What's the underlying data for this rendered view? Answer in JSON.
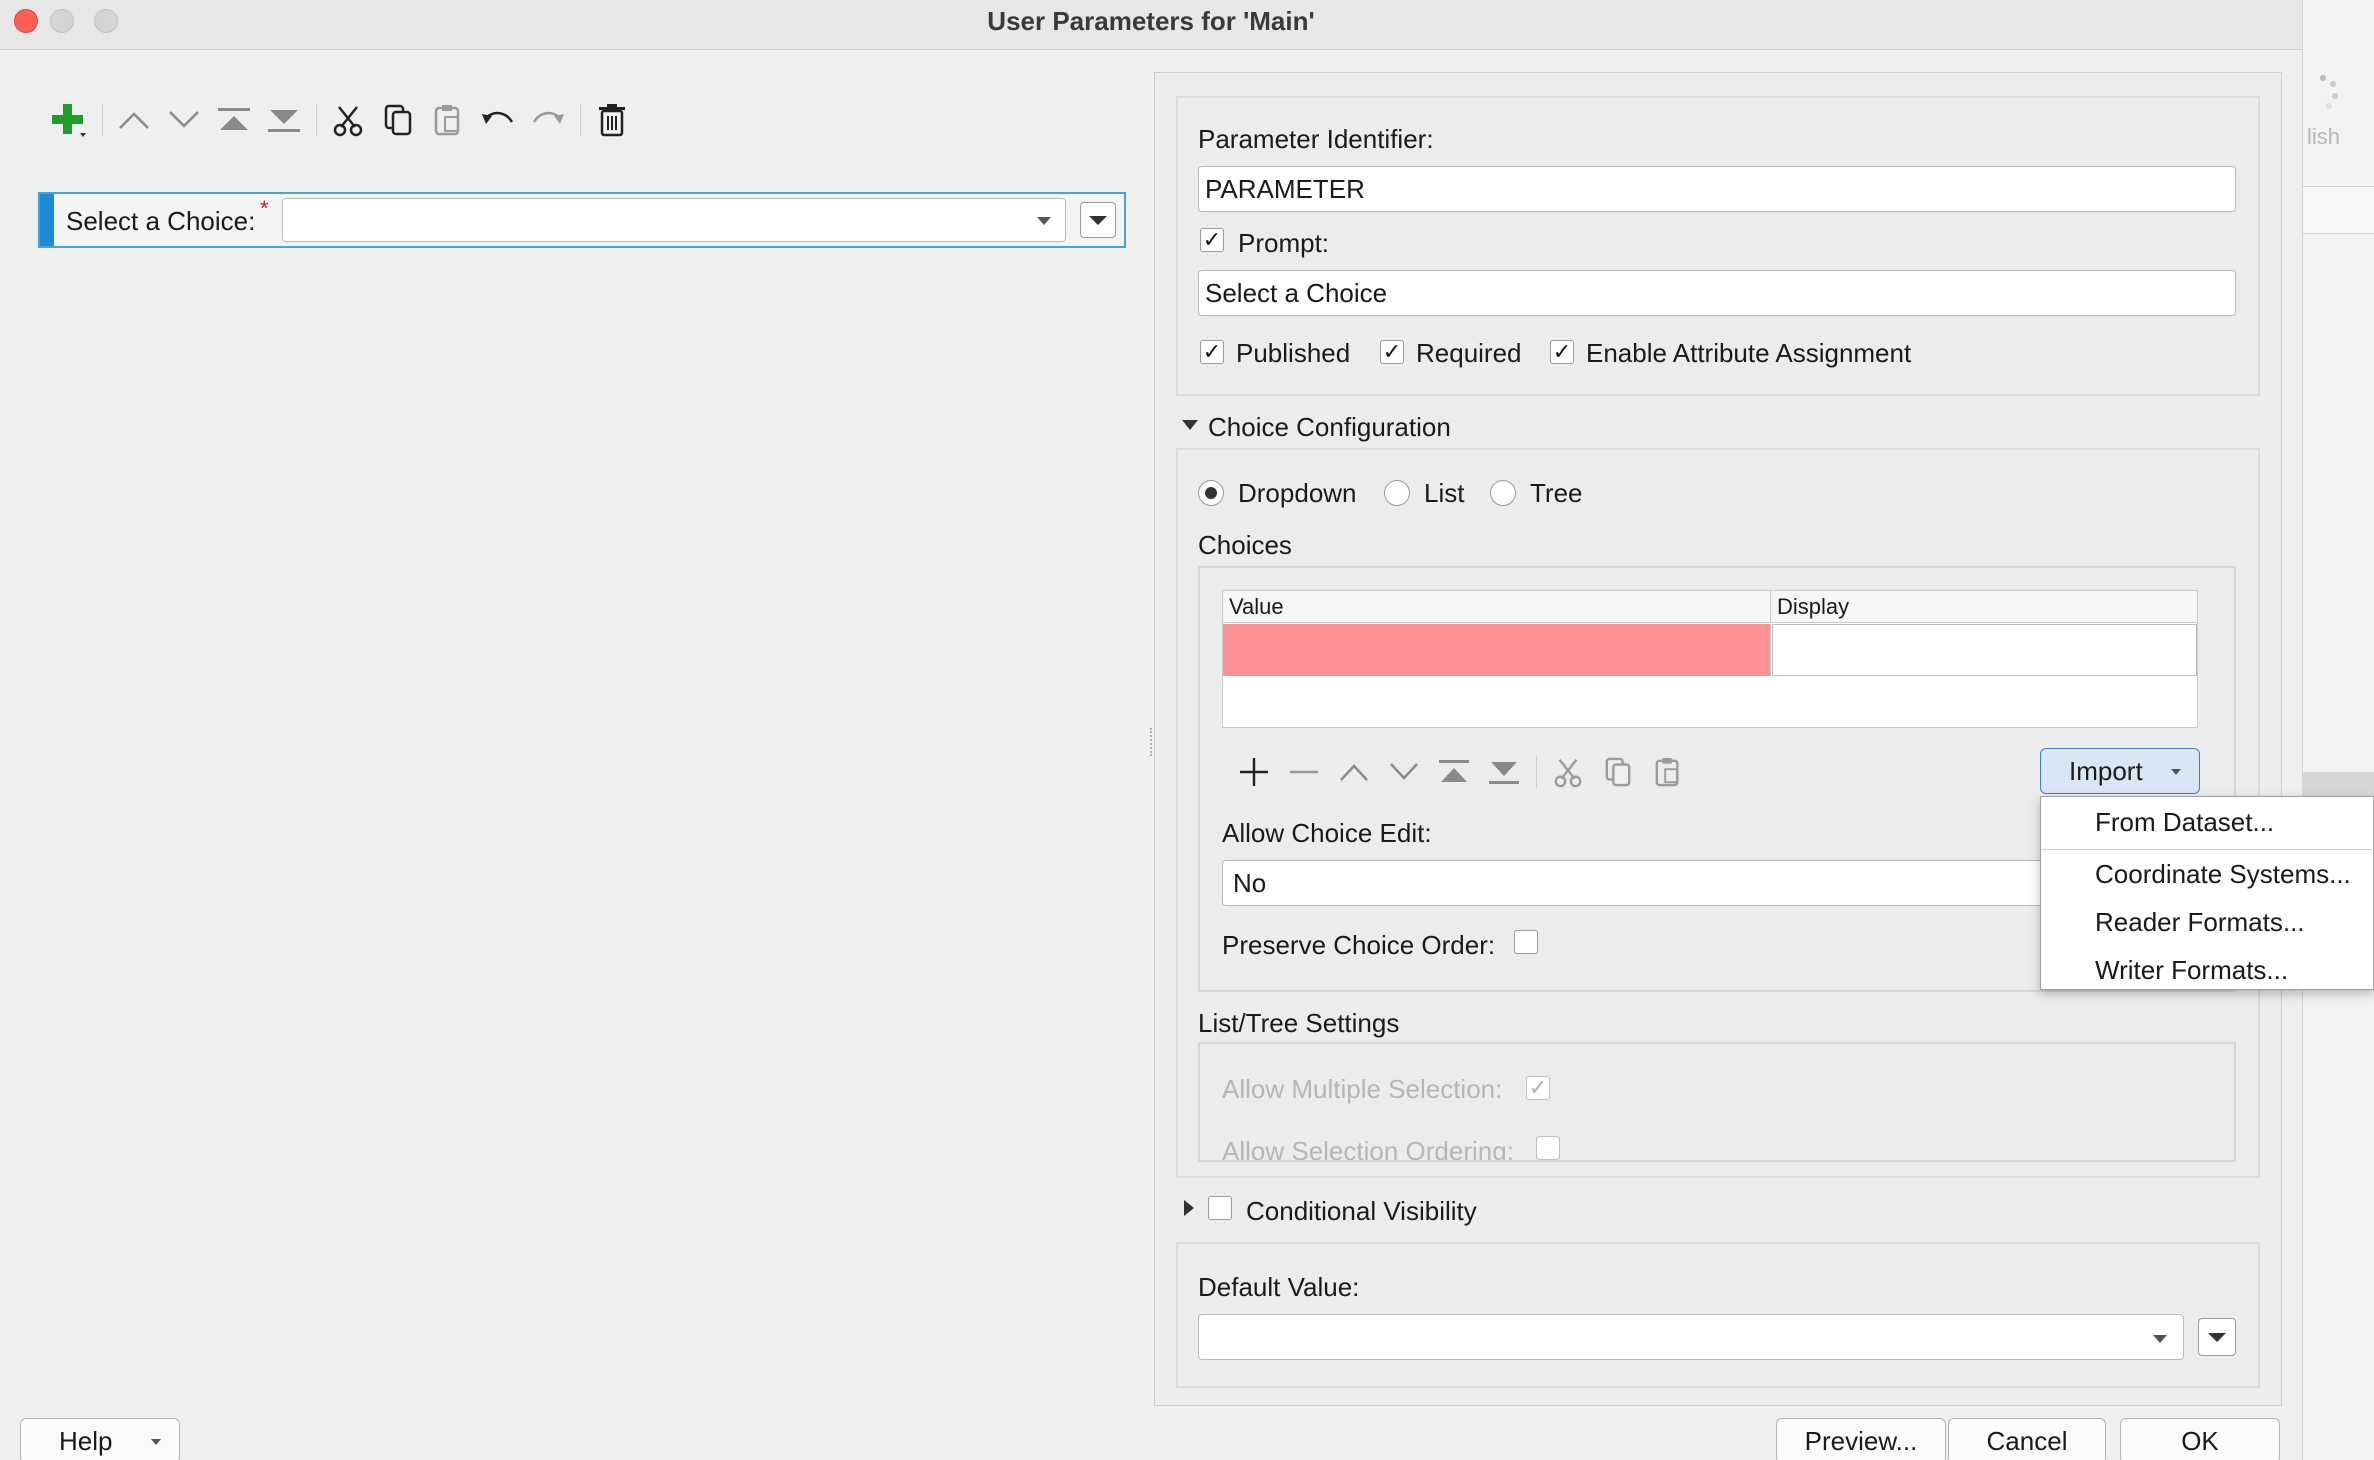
{
  "window": {
    "title": "User Parameters for 'Main'",
    "behind_window_partial_text": "lish"
  },
  "left_panel": {
    "param_row": {
      "label": "Select a Choice:",
      "required_marker": "*",
      "value": ""
    }
  },
  "properties": {
    "identifier_label": "Parameter Identifier:",
    "identifier_value": "PARAMETER",
    "prompt_checked": true,
    "prompt_label": "Prompt:",
    "prompt_value": "Select a Choice",
    "published_label": "Published",
    "published_checked": true,
    "required_label": "Required",
    "required_checked": true,
    "enable_attr_label": "Enable Attribute Assignment",
    "enable_attr_checked": true
  },
  "choice_config": {
    "section_title": "Choice Configuration",
    "modes": [
      {
        "label": "Dropdown",
        "selected": true
      },
      {
        "label": "List",
        "selected": false
      },
      {
        "label": "Tree",
        "selected": false
      }
    ],
    "choices_label": "Choices",
    "table": {
      "columns": [
        "Value",
        "Display"
      ],
      "rows": [
        [
          "",
          ""
        ]
      ]
    },
    "import_button": "Import",
    "allow_choice_edit_label": "Allow Choice Edit:",
    "allow_choice_edit_value": "No",
    "preserve_order_label": "Preserve Choice Order:",
    "preserve_order_checked": false
  },
  "import_menu": {
    "items": [
      "From Dataset...",
      "Coordinate Systems...",
      "Reader Formats...",
      "Writer Formats..."
    ]
  },
  "list_tree_settings": {
    "title": "List/Tree Settings",
    "allow_multiple_label": "Allow Multiple Selection:",
    "allow_multiple_checked": true,
    "allow_ordering_label": "Allow Selection Ordering:",
    "allow_ordering_checked": false
  },
  "conditional_visibility": {
    "label": "Conditional Visibility",
    "checked": false
  },
  "default_value": {
    "label": "Default Value:",
    "value": ""
  },
  "footer": {
    "help": "Help",
    "preview": "Preview...",
    "cancel": "Cancel",
    "ok": "OK"
  },
  "colors": {
    "invalid_cell": "#ff8f93",
    "selection_accent": "#1e8ad6",
    "add_icon": "#1f9d2a"
  }
}
